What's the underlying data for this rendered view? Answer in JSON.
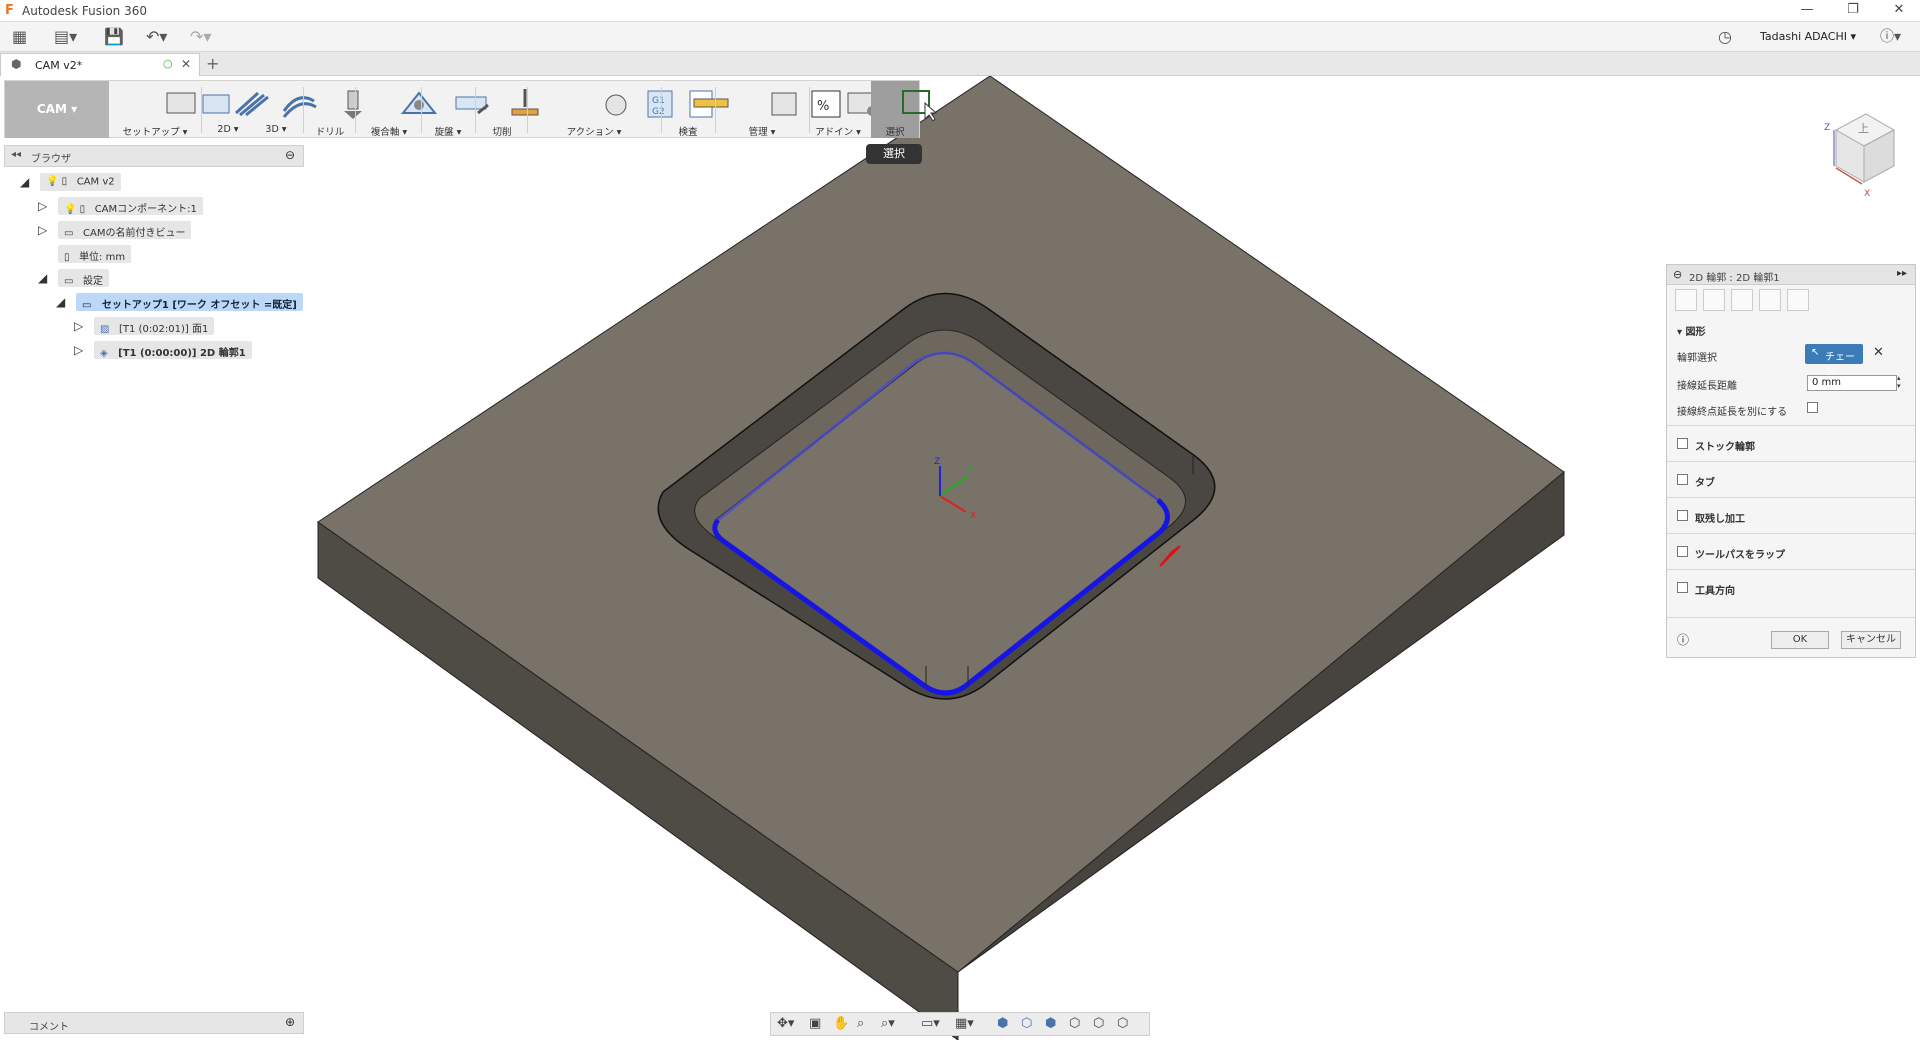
{
  "app": {
    "title": "Autodesk Fusion 360"
  },
  "user": {
    "name": "Tadashi ADACHI"
  },
  "tab": {
    "doc_name": "CAM v2*"
  },
  "toolbar": {
    "workspace": "CAM",
    "buttons": [
      {
        "key": "setup",
        "label": "セットアップ ▾"
      },
      {
        "key": "2d",
        "label": "2D ▾"
      },
      {
        "key": "3d",
        "label": "3D ▾"
      },
      {
        "key": "drill",
        "label": "ドリル"
      },
      {
        "key": "multiaxis",
        "label": "複合軸 ▾"
      },
      {
        "key": "turning",
        "label": "旋盤 ▾"
      },
      {
        "key": "cutting",
        "label": "切削"
      },
      {
        "key": "actions",
        "label": "アクション ▾"
      },
      {
        "key": "inspect",
        "label": "検査"
      },
      {
        "key": "manage",
        "label": "管理 ▾"
      },
      {
        "key": "addins",
        "label": "アドイン ▾"
      },
      {
        "key": "select",
        "label": "選択"
      }
    ],
    "tooltip": "選択"
  },
  "browser": {
    "title": "ブラウザ",
    "tree": [
      {
        "label": "CAM v2"
      },
      {
        "label": "CAMコンポーネント:1"
      },
      {
        "label": "CAMの名前付きビュー"
      },
      {
        "label": "単位: mm"
      },
      {
        "label": "設定"
      },
      {
        "label": "セットアップ1 [ワーク オフセット =既定]"
      },
      {
        "label": "[T1 (0:02:01)] 面1"
      },
      {
        "label": "[T1 (0:00:00)] 2D 輪郭1"
      }
    ]
  },
  "comments": {
    "title": "コメント"
  },
  "panel": {
    "title": "2D 輪郭 : 2D 輪郭1",
    "section_geometry": "図形",
    "contour_select_label": "輪郭選択",
    "chain_button": "チェーン",
    "tangent_ext_label": "接線延長距離",
    "tangent_ext_value": "0 mm",
    "separate_ext_label": "接線終点延長を別にする",
    "sections": [
      "ストック輪郭",
      "タブ",
      "取残し加工",
      "ツールパスをラップ",
      "工具方向"
    ],
    "ok": "OK",
    "cancel": "キャンセル"
  },
  "colors": {
    "model_top": "#797268",
    "model_side": "#4f4b45",
    "toolpath": "#1515e6",
    "accent": "#3d7ab8"
  }
}
